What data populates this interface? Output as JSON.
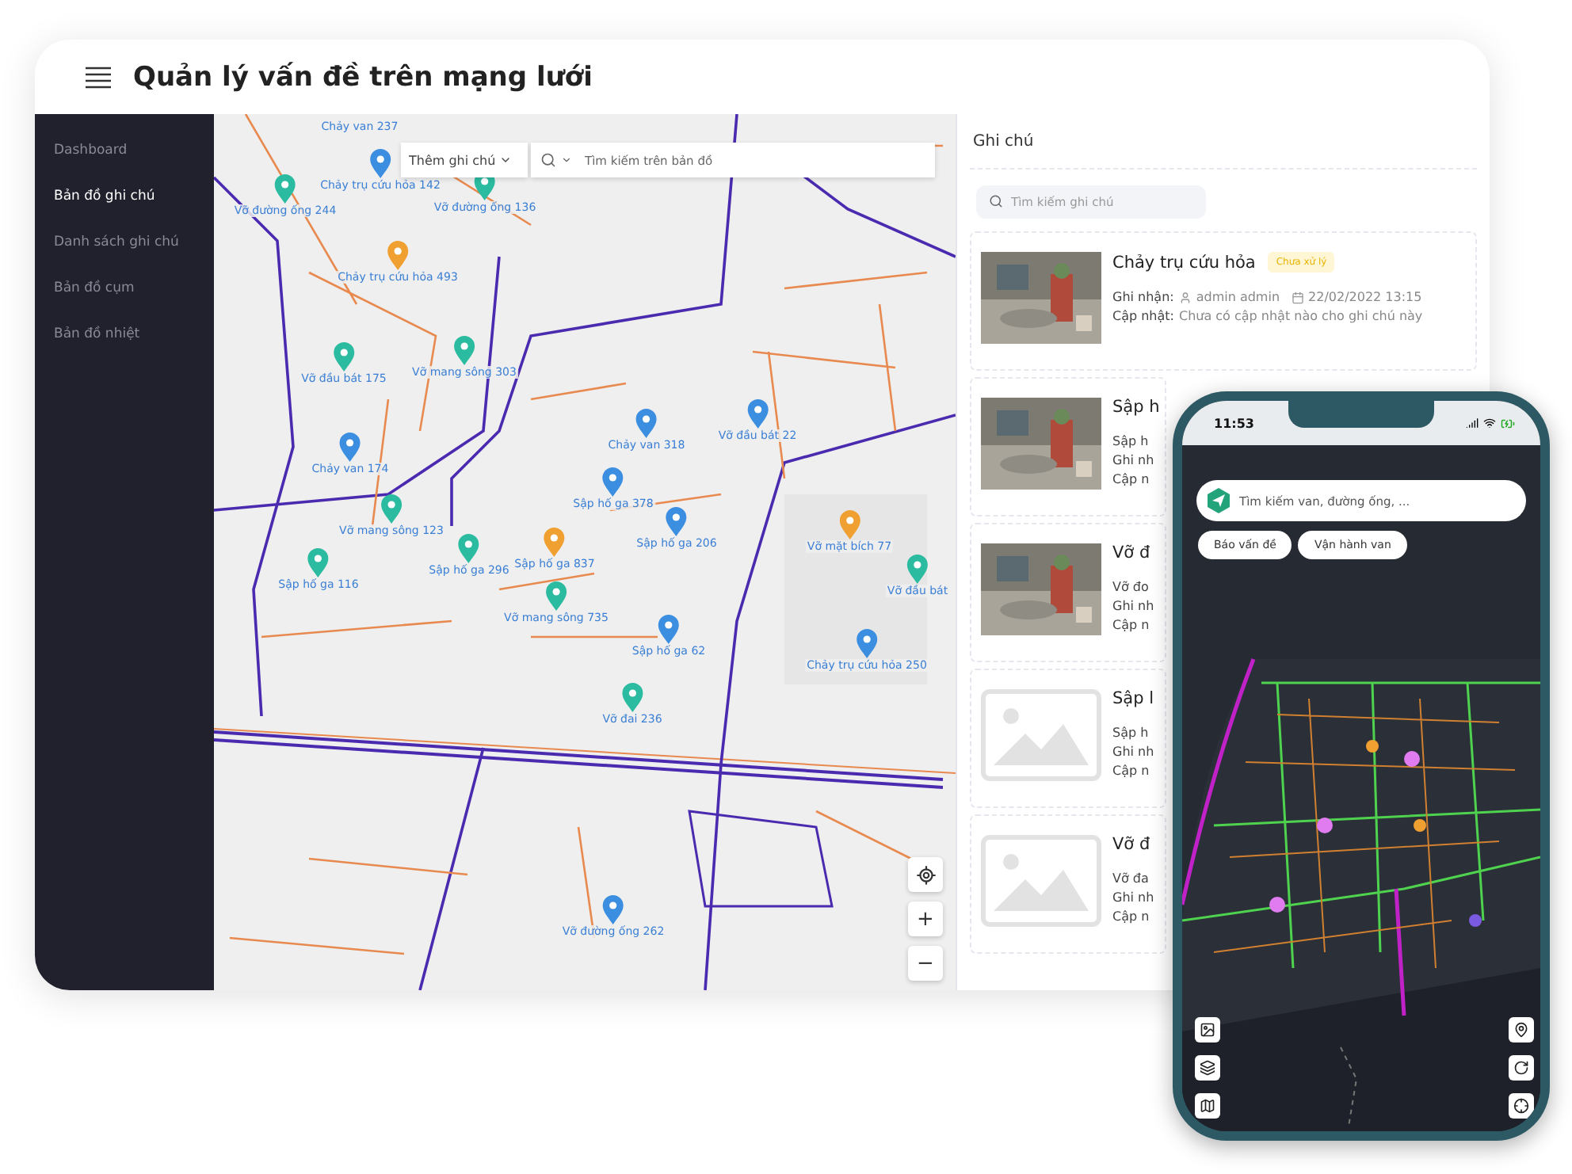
{
  "header": {
    "title": "Quản lý vấn đề trên mạng lưới"
  },
  "sidebar": {
    "items": [
      {
        "label": "Dashboard",
        "selected": false
      },
      {
        "label": "Bản đồ ghi chú",
        "selected": true
      },
      {
        "label": "Danh sách ghi chú",
        "selected": false
      },
      {
        "label": "Bản đồ cụm",
        "selected": false
      },
      {
        "label": "Bản đồ nhiệt",
        "selected": false
      }
    ]
  },
  "map": {
    "kind": "picture",
    "add_note": {
      "label": "Thêm ghi chú"
    },
    "search": {
      "placeholder": "Tìm kiếm trên bản đồ"
    },
    "markers": [
      {
        "kind": "label",
        "label": "Chảy van 237"
      },
      {
        "kind": "pin",
        "label": "Chảy trụ cứu hỏa 142",
        "color": "#3c8fe0"
      },
      {
        "kind": "pin",
        "label": "Vỡ đường ống 244",
        "color": "#2bbba0"
      },
      {
        "kind": "pin",
        "label": "Vỡ đường ống 136",
        "color": "#2bbba0"
      },
      {
        "kind": "pin",
        "label": "Chảy trụ cứu hỏa 493",
        "color": "#f0a030"
      },
      {
        "kind": "pin",
        "label": "Vỡ đầu bát 175",
        "color": "#2bbba0"
      },
      {
        "kind": "pin",
        "label": "Vỡ mang sông 303",
        "color": "#2bbba0"
      },
      {
        "kind": "pin",
        "label": "Chảy van 318",
        "color": "#3c8fe0"
      },
      {
        "kind": "pin",
        "label": "Vỡ đầu bát 22",
        "color": "#3c8fe0"
      },
      {
        "kind": "pin",
        "label": "Chảy van 174",
        "color": "#3c8fe0"
      },
      {
        "kind": "pin",
        "label": "Sập hố ga 378",
        "color": "#3c8fe0"
      },
      {
        "kind": "pin",
        "label": "Vỡ mang sông 123",
        "color": "#2bbba0"
      },
      {
        "kind": "pin",
        "label": "Sập hố ga 206",
        "color": "#3c8fe0"
      },
      {
        "kind": "pin",
        "label": "Vỡ mặt bích 77",
        "color": "#f0a030"
      },
      {
        "kind": "pin",
        "label": "Sập hố ga 296",
        "color": "#2bbba0"
      },
      {
        "kind": "pin",
        "label": "Sập hố ga 837",
        "color": "#f0a030"
      },
      {
        "kind": "pin",
        "label": "Sập hố ga 116",
        "color": "#2bbba0"
      },
      {
        "kind": "pin",
        "label": "Vỡ đầu bát",
        "color": "#2bbba0"
      },
      {
        "kind": "pin",
        "label": "Vỡ mang sông 735",
        "color": "#2bbba0"
      },
      {
        "kind": "pin",
        "label": "Sập hố ga 62",
        "color": "#3c8fe0"
      },
      {
        "kind": "pin",
        "label": "Chảy trụ cứu hỏa 250",
        "color": "#3c8fe0"
      },
      {
        "kind": "pin",
        "label": "Vỡ đai 236",
        "color": "#2bbba0"
      },
      {
        "kind": "pin",
        "label": "Vỡ đường ống 262",
        "color": "#3c8fe0"
      }
    ],
    "controls": [
      {
        "kind": "locate"
      },
      {
        "kind": "zoom_in",
        "label": "+"
      },
      {
        "kind": "zoom_out",
        "label": "−"
      }
    ]
  },
  "notes": {
    "title": "Ghi chú",
    "search": {
      "placeholder": "Tìm kiếm ghi chú"
    },
    "cards": [
      {
        "title": "Chảy trụ cứu hỏa",
        "badge": "Chưa xử lý",
        "lines": [
          {
            "label": "Ghi nhận:",
            "user": "admin admin",
            "date": "22/02/2022 13:15"
          },
          {
            "label": "Cập nhật:",
            "text": "Chưa có cập nhật nào cho ghi chú này"
          }
        ]
      },
      {
        "title": "Sập h",
        "lines": [
          {
            "text": "Sập h"
          },
          {
            "text": "Ghi nh"
          },
          {
            "text": "Cập n"
          }
        ]
      },
      {
        "title": "Vỡ đ",
        "lines": [
          {
            "text": "Vỡ đo"
          },
          {
            "text": "Ghi nh"
          },
          {
            "text": "Cập n"
          }
        ]
      },
      {
        "kind": "placeholder",
        "title": "Sập l",
        "lines": [
          {
            "text": "Sập h"
          },
          {
            "text": "Ghi nh"
          },
          {
            "text": "Cập n"
          }
        ]
      },
      {
        "kind": "placeholder",
        "title": "Vỡ đ",
        "lines": [
          {
            "text": "Vỡ đa"
          },
          {
            "text": "Ghi nh"
          },
          {
            "text": "Cập n"
          }
        ]
      }
    ]
  },
  "phone": {
    "time": "11:53",
    "search": {
      "placeholder": "Tìm kiếm van, đường ống, ..."
    },
    "chips": [
      "Báo vấn đề",
      "Vận hành van"
    ],
    "map": {
      "kind": "picture"
    }
  }
}
